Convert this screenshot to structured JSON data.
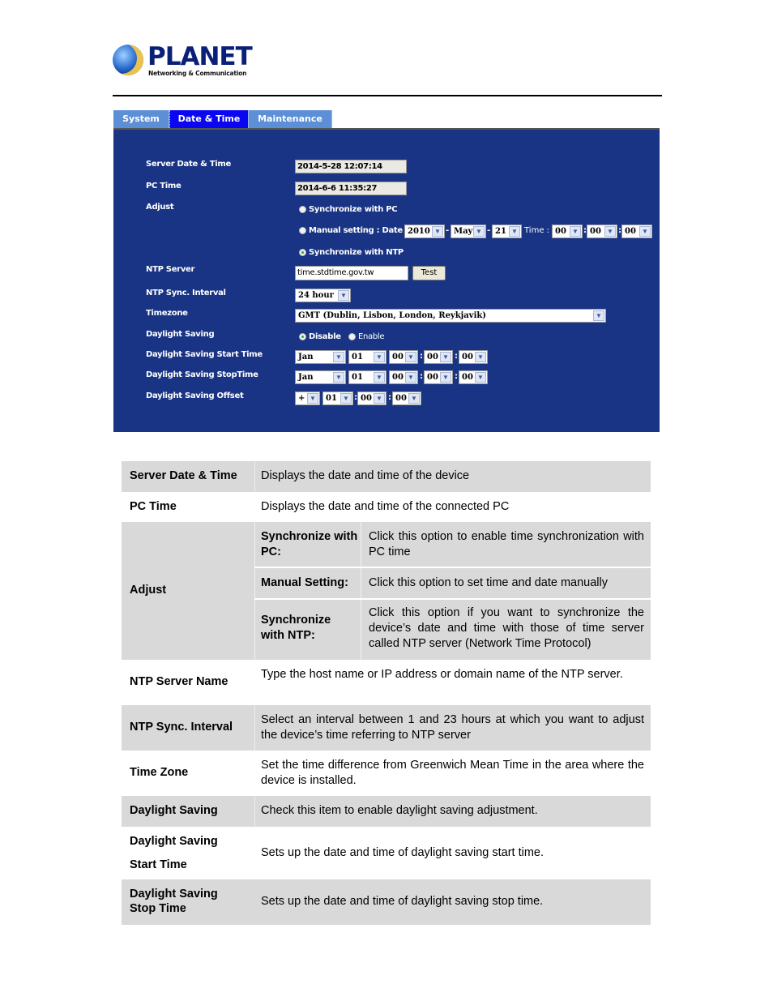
{
  "logo": {
    "brand": "PLANET",
    "tagline": "Networking & Communication"
  },
  "tabs": [
    {
      "label": "System",
      "active": false
    },
    {
      "label": "Date & Time",
      "active": true
    },
    {
      "label": "Maintenance",
      "active": false
    }
  ],
  "colors": {
    "panel_bg": "#193484",
    "tab_active": "#0a06f2",
    "tab_inactive": "#5c8fd6",
    "row_shade": "#d9d9d9"
  },
  "panel": {
    "server_date_time": {
      "label": "Server Date & Time",
      "value": "2014-5-28 12:07:14"
    },
    "pc_time": {
      "label": "PC Time",
      "value": "2014-6-6 11:35:27"
    },
    "adjust": {
      "label": "Adjust",
      "sync_pc": {
        "label": "Synchronize with PC",
        "checked": false
      },
      "manual": {
        "label": "Manual setting : Date :",
        "year": "2010",
        "month": "May",
        "day": "21",
        "time_label": "Time :",
        "hour": "00",
        "minute": "00",
        "second": "00",
        "checked": false
      },
      "sync_ntp": {
        "label": "Synchronize with NTP",
        "checked": true
      }
    },
    "ntp_server": {
      "label": "NTP Server",
      "value": "time.stdtime.gov.tw",
      "test_button": "Test"
    },
    "ntp_interval": {
      "label": "NTP Sync. Interval",
      "value": "24  hour"
    },
    "timezone": {
      "label": "Timezone",
      "value": "GMT  (Dublin, Lisbon, London, Reykjavik)"
    },
    "daylight_saving": {
      "label": "Daylight Saving",
      "disable": "Disable",
      "enable": "Enable",
      "selected": "Disable"
    },
    "ds_start": {
      "label": "Daylight Saving Start Time",
      "month": "Jan",
      "day": "01",
      "hour": "00",
      "minute": "00",
      "second": "00"
    },
    "ds_stop": {
      "label": "Daylight Saving StopTime",
      "month": "Jan",
      "day": "01",
      "hour": "00",
      "minute": "00",
      "second": "00"
    },
    "ds_offset": {
      "label": "Daylight Saving Offset",
      "sign": "+",
      "hour": "01",
      "minute": "00",
      "second": "00"
    }
  },
  "table": {
    "rows": [
      {
        "term": "Server Date & Time",
        "definition": "Displays the date and time of the device"
      },
      {
        "term": "PC Time",
        "definition": "Displays the date and time of the connected PC"
      },
      {
        "term": "Adjust",
        "sub": [
          {
            "term": "Synchronize with PC:",
            "definition": "Click this option to enable time synchronization with PC time"
          },
          {
            "term": "Manual Setting:",
            "definition": "Click this option to set time and date manually"
          },
          {
            "term": "Synchronize with NTP:",
            "definition": "Click this option if you want to synchronize the device’s date and time with those of time server called NTP server (Network Time Protocol)"
          }
        ]
      },
      {
        "term": "NTP Server Name",
        "definition": "Type the host name or IP address or domain name of the NTP server."
      },
      {
        "term": "NTP Sync. Interval",
        "definition": "Select an interval between 1 and 23 hours at which you want to adjust the device’s time referring to NTP server"
      },
      {
        "term": "Time Zone",
        "definition": "Set the time difference from Greenwich Mean Time in the area where the device is installed."
      },
      {
        "term": "Daylight Saving",
        "definition": "Check this item to enable daylight saving adjustment."
      },
      {
        "term_line1": "Daylight Saving",
        "term_line2": "Start Time",
        "definition": "Sets up the date and time of daylight saving start time."
      },
      {
        "term_line1": "Daylight Saving",
        "term_line2": "Stop Time",
        "definition": "Sets up the date and time of daylight saving stop time."
      }
    ]
  }
}
